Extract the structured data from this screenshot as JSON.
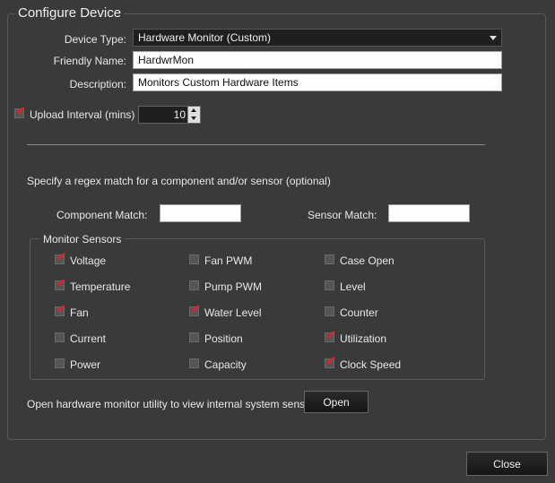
{
  "group": {
    "title": "Configure Device"
  },
  "device_type": {
    "label": "Device Type:",
    "value": "Hardware Monitor (Custom)"
  },
  "friendly_name": {
    "label": "Friendly Name:",
    "value": "HardwrMon"
  },
  "description": {
    "label": "Description:",
    "value": "Monitors Custom Hardware Items"
  },
  "upload_interval": {
    "label": "Upload Interval (mins)",
    "checked": true,
    "value": "10"
  },
  "regex": {
    "prompt": "Specify a regex match for a component and/or sensor (optional)",
    "component_label": "Component Match:",
    "component_value": "",
    "sensor_label": "Sensor Match:",
    "sensor_value": ""
  },
  "sensors": {
    "title": "Monitor Sensors",
    "items": [
      {
        "label": "Voltage",
        "checked": true
      },
      {
        "label": "Temperature",
        "checked": true
      },
      {
        "label": "Fan",
        "checked": true
      },
      {
        "label": "Current",
        "checked": false
      },
      {
        "label": "Power",
        "checked": false
      },
      {
        "label": "Fan PWM",
        "checked": false
      },
      {
        "label": "Pump PWM",
        "checked": false
      },
      {
        "label": "Water Level",
        "checked": true
      },
      {
        "label": "Position",
        "checked": false
      },
      {
        "label": "Capacity",
        "checked": false
      },
      {
        "label": "Case Open",
        "checked": false
      },
      {
        "label": "Level",
        "checked": false
      },
      {
        "label": "Counter",
        "checked": false
      },
      {
        "label": "Utilization",
        "checked": true
      },
      {
        "label": "Clock Speed",
        "checked": true
      }
    ]
  },
  "open_utility": {
    "text": "Open hardware monitor utility to view internal system sensors",
    "button": "Open"
  },
  "close_button": "Close",
  "colors": {
    "background": "#3a3a3a",
    "check": "#d9232d",
    "field_dark": "#1f1f1f"
  }
}
